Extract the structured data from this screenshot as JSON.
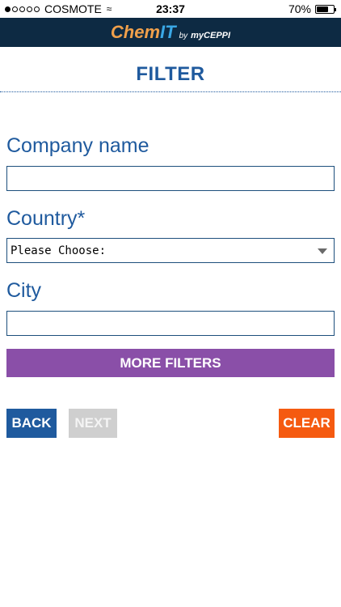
{
  "status_bar": {
    "carrier": "COSMOTE",
    "time": "23:37",
    "battery": "70%",
    "battery_level": 0.7
  },
  "header": {
    "logo_chem": "Chem",
    "logo_it": "IT",
    "logo_by": "by",
    "logo_brand": "myCEPPI"
  },
  "page": {
    "title": "FILTER"
  },
  "form": {
    "company_label": "Company name",
    "company_value": "",
    "country_label": "Country*",
    "country_selected": "Please Choose:",
    "city_label": "City",
    "city_value": ""
  },
  "buttons": {
    "more_filters": "MORE FILTERS",
    "back": "BACK",
    "next": "NEXT",
    "clear": "CLEAR"
  },
  "colors": {
    "header_bg": "#0d2a43",
    "accent_blue": "#1f5a9e",
    "purple": "#8a4fa8",
    "orange": "#f55a10",
    "disabled_gray": "#cfcfcf"
  }
}
